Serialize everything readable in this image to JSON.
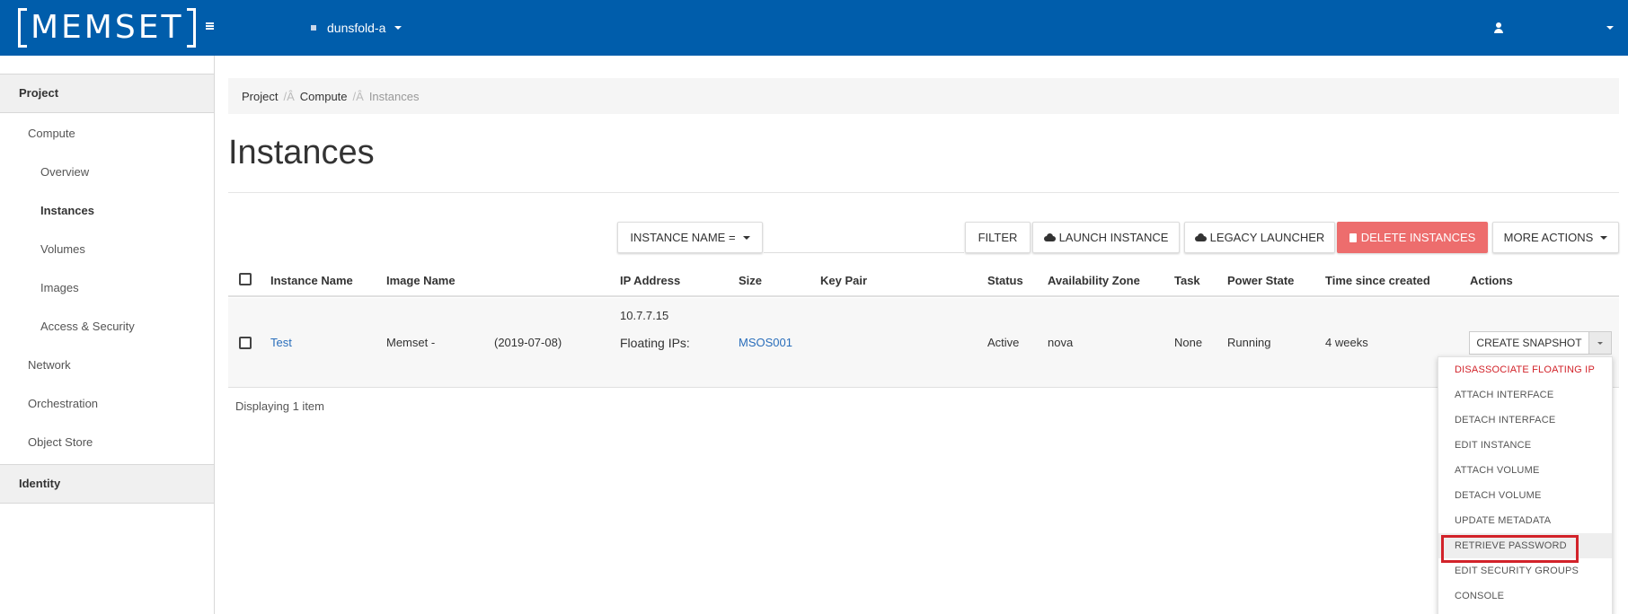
{
  "brand": {
    "logo_text": "MEMSET",
    "colors": {
      "primary": "#005dab",
      "danger": "#ed6d6d",
      "link": "#2a6ebb",
      "menu_danger": "#d2232a"
    }
  },
  "topnav": {
    "project_name": "dunsfold-a",
    "user_name": ""
  },
  "sidebar": {
    "sections": [
      {
        "label": "Project"
      },
      {
        "label": "Identity"
      }
    ],
    "items": [
      {
        "label": "Compute"
      },
      {
        "label": "Overview"
      },
      {
        "label": "Instances"
      },
      {
        "label": "Volumes"
      },
      {
        "label": "Images"
      },
      {
        "label": "Access & Security"
      },
      {
        "label": "Network"
      },
      {
        "label": "Orchestration"
      },
      {
        "label": "Object Store"
      }
    ]
  },
  "breadcrumb": {
    "items": [
      "Project",
      "Compute",
      "Instances"
    ],
    "separator": "/Â"
  },
  "page": {
    "title": "Instances"
  },
  "toolbar": {
    "filter_field": "INSTANCE NAME =",
    "filter_value": "",
    "filter_label": "FILTER",
    "launch_label": "LAUNCH INSTANCE",
    "legacy_label": "LEGACY LAUNCHER",
    "delete_label": "DELETE INSTANCES",
    "more_label": "MORE ACTIONS"
  },
  "table": {
    "columns": [
      "Instance Name",
      "Image Name",
      "IP Address",
      "Size",
      "Key Pair",
      "Status",
      "Availability Zone",
      "Task",
      "Power State",
      "Time since created",
      "Actions"
    ],
    "rows": [
      {
        "name": "Test",
        "image": "Memset -",
        "image_date": "(2019-07-08)",
        "ip": "10.7.7.15",
        "floating": "Floating IPs:",
        "size": "MSOS001",
        "key_pair": "",
        "status": "Active",
        "zone": "nova",
        "task": "None",
        "power": "Running",
        "age": "4 weeks",
        "action": "CREATE SNAPSHOT"
      }
    ],
    "footer": "Displaying 1 item"
  },
  "action_menu": {
    "items": [
      "DISASSOCIATE FLOATING IP",
      "ATTACH INTERFACE",
      "DETACH INTERFACE",
      "EDIT INSTANCE",
      "ATTACH VOLUME",
      "DETACH VOLUME",
      "UPDATE METADATA",
      "RETRIEVE PASSWORD",
      "EDIT SECURITY GROUPS",
      "CONSOLE"
    ]
  }
}
